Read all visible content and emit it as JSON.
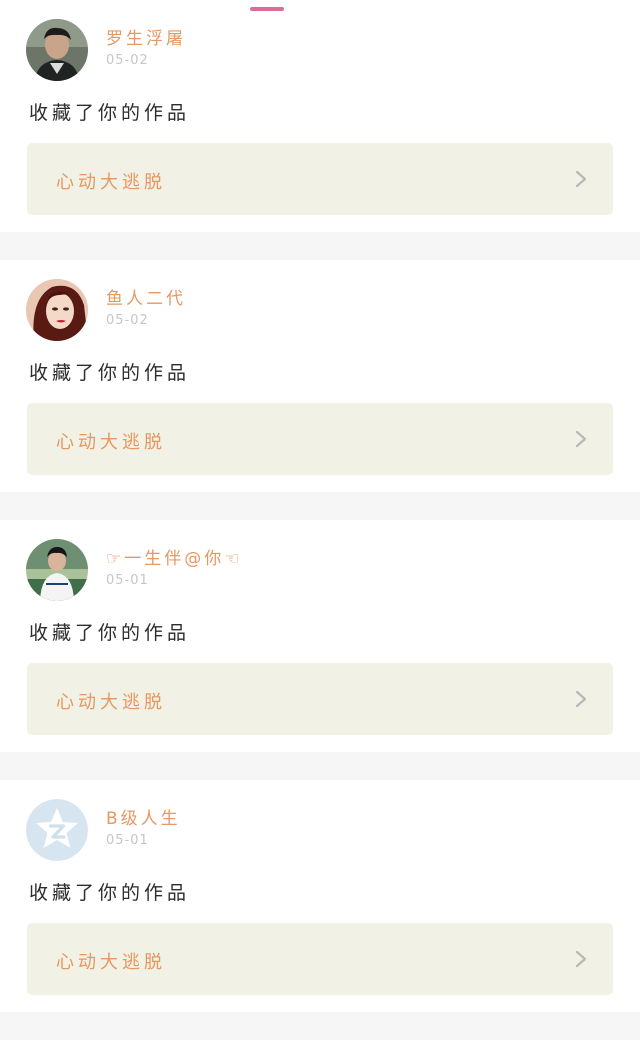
{
  "feed": [
    {
      "username": "罗生浮屠",
      "date": "05-02",
      "action": "收藏了你的作品",
      "work_title": "心动大逃脱",
      "avatar_icon": "male-user-avatar-icon"
    },
    {
      "username": "鱼人二代",
      "date": "05-02",
      "action": "收藏了你的作品",
      "work_title": "心动大逃脱",
      "avatar_icon": "female-user-avatar-icon"
    },
    {
      "username": "☞一生伴@你☜",
      "date": "05-01",
      "action": "收藏了你的作品",
      "work_title": "心动大逃脱",
      "avatar_icon": "boy-user-avatar-icon"
    },
    {
      "username": "B级人生",
      "date": "05-01",
      "action": "收藏了你的作品",
      "work_title": "心动大逃脱",
      "avatar_icon": "qzone-default-avatar-icon"
    }
  ],
  "colors": {
    "accent": "#e79761",
    "tab_indicator": "#d96f99",
    "card_link_bg": "#f1f2e5",
    "divider_bg": "#f6f6f6",
    "date": "#c6c6c6"
  },
  "icons": {
    "chevron": "chevron-right-icon"
  }
}
